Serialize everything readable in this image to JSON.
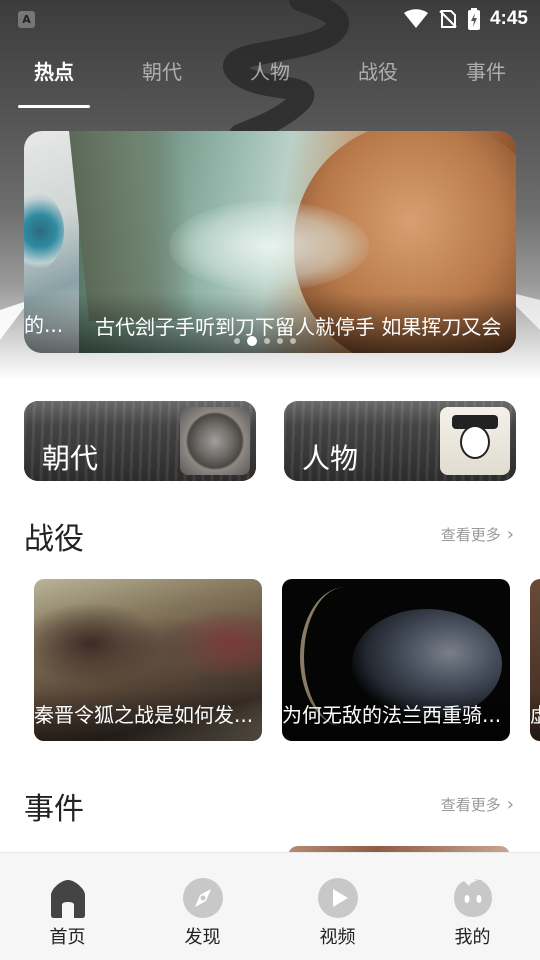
{
  "status_bar": {
    "app_icon_letter": "A",
    "time": "4:45"
  },
  "tabs": [
    {
      "label": "热点",
      "active": true
    },
    {
      "label": "朝代",
      "active": false
    },
    {
      "label": "人物",
      "active": false
    },
    {
      "label": "战役",
      "active": false
    },
    {
      "label": "事件",
      "active": false
    }
  ],
  "banner": {
    "prev_caption": "的...",
    "caption": "古代刽子手听到刀下留人就停手 如果挥刀又会",
    "dot_count": 5,
    "active_dot": 1
  },
  "categories": [
    {
      "label": "朝代",
      "thumb": "bronze-coin-image"
    },
    {
      "label": "人物",
      "thumb": "portrait-sketch-image"
    }
  ],
  "battles": {
    "title": "战役",
    "more_label": "查看更多",
    "items": [
      {
        "caption": "秦晋令狐之战是如何发..."
      },
      {
        "caption": "为何无敌的法兰西重骑..."
      },
      {
        "caption": "虚"
      }
    ]
  },
  "events": {
    "title": "事件",
    "more_label": "查看更多"
  },
  "bottom_nav": [
    {
      "label": "首页",
      "icon": "home-icon",
      "active": true
    },
    {
      "label": "发现",
      "icon": "compass-icon",
      "active": false
    },
    {
      "label": "视频",
      "icon": "play-icon",
      "active": false
    },
    {
      "label": "我的",
      "icon": "profile-face-icon",
      "active": false
    }
  ],
  "colors": {
    "nav_active": "#444444",
    "nav_inactive": "#c8c8c8",
    "section_title": "#222222",
    "more_text": "#999999"
  }
}
